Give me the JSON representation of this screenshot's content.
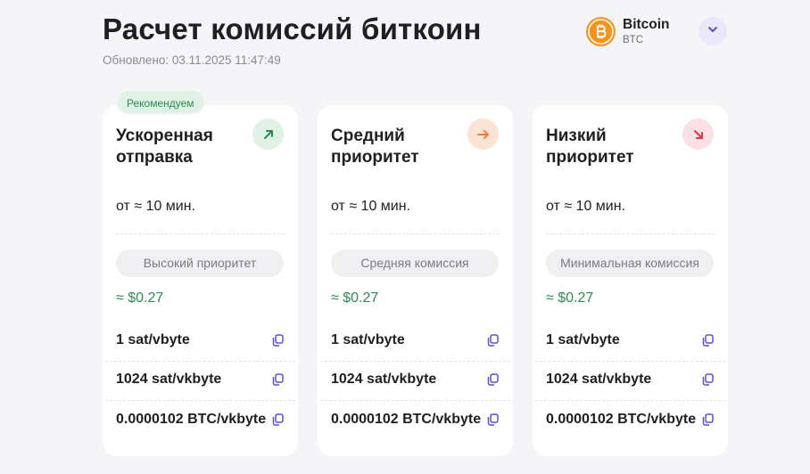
{
  "page": {
    "title": "Расчет комиссий биткоин",
    "updated": "Обновлено: 03.11.2025 11:47:49"
  },
  "coin": {
    "name": "Bitcoin",
    "ticker": "BTC",
    "logo_color": "#f7931a"
  },
  "badge": "Рекомендуем",
  "cards": [
    {
      "title": "Ускоренная отправка",
      "icon": "arrow-up-right-icon",
      "icon_bg": "#dff2e5",
      "icon_color": "#2e8b4f",
      "time": "от ≈ 10 мин.",
      "pill": "Высокий приоритет",
      "usd": "≈ $0.27",
      "rows": [
        "1 sat/vbyte",
        "1024 sat/vkbyte",
        "0.0000102 BTC/vkbyte"
      ]
    },
    {
      "title": "Средний приоритет",
      "icon": "arrow-right-icon",
      "icon_bg": "#fde3d4",
      "icon_color": "#f07b3a",
      "time": "от ≈ 10 мин.",
      "pill": "Средняя комиссия",
      "usd": "≈ $0.27",
      "rows": [
        "1 sat/vbyte",
        "1024 sat/vkbyte",
        "0.0000102 BTC/vkbyte"
      ]
    },
    {
      "title": "Низкий приоритет",
      "icon": "arrow-down-right-icon",
      "icon_bg": "#fce0e3",
      "icon_color": "#e0354b",
      "time": "от ≈ 10 мин.",
      "pill": "Минимальная комиссия",
      "usd": "≈ $0.27",
      "rows": [
        "1 sat/vbyte",
        "1024 sat/vkbyte",
        "0.0000102 BTC/vkbyte"
      ]
    }
  ],
  "colors": {
    "accent": "#5b4fd6",
    "green": "#2e8b4f"
  }
}
